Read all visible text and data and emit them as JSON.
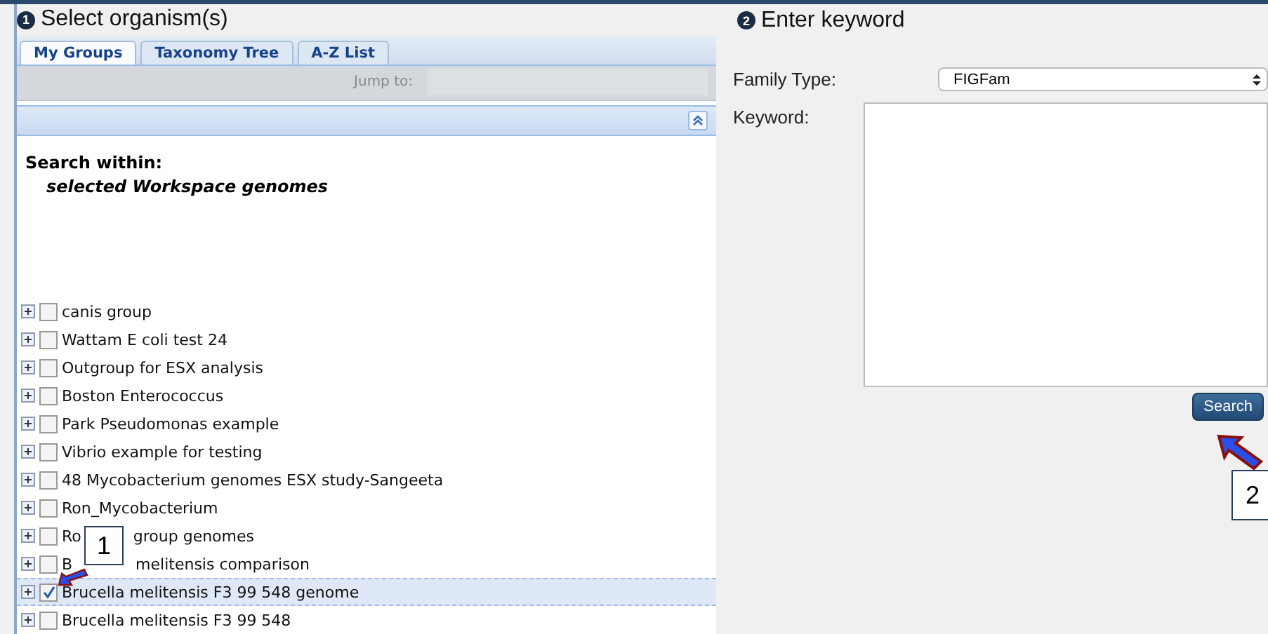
{
  "left_panel": {
    "step": "1",
    "title": "Select organism(s)",
    "tabs": [
      {
        "label": "My Groups",
        "selected": true
      },
      {
        "label": "Taxonomy Tree",
        "selected": false
      },
      {
        "label": "A-Z List",
        "selected": false
      }
    ],
    "jump_to": {
      "label": "Jump to:"
    },
    "search_within": {
      "heading": "Search within:",
      "value": "selected Workspace genomes"
    },
    "groups": [
      {
        "label_parts": [
          "canis group"
        ],
        "checked": false,
        "selected": false
      },
      {
        "label_parts": [
          "Wattam E coli test 24"
        ],
        "checked": false,
        "selected": false
      },
      {
        "label_parts": [
          "Outgroup for ESX analysis"
        ],
        "checked": false,
        "selected": false
      },
      {
        "label_parts": [
          "Boston Enterococcus"
        ],
        "checked": false,
        "selected": false
      },
      {
        "label_parts": [
          "Park Pseudomonas example"
        ],
        "checked": false,
        "selected": false
      },
      {
        "label_parts": [
          "Vibrio example for testing"
        ],
        "checked": false,
        "selected": false
      },
      {
        "label_parts": [
          "48 Mycobacterium genomes ESX study-Sangeeta"
        ],
        "checked": false,
        "selected": false
      },
      {
        "label_parts": [
          "Ron_Mycobacterium"
        ],
        "checked": false,
        "selected": false
      },
      {
        "label_parts": [
          "Ro",
          "group genomes"
        ],
        "checked": false,
        "selected": false
      },
      {
        "label_parts": [
          "B",
          "melitensis comparison"
        ],
        "checked": false,
        "selected": false
      },
      {
        "label_parts": [
          "Brucella melitensis F3 99 548 genome"
        ],
        "checked": true,
        "selected": true
      },
      {
        "label_parts": [
          "Brucella melitensis F3 99 548"
        ],
        "checked": false,
        "selected": false
      }
    ]
  },
  "right_panel": {
    "step": "2",
    "title": "Enter keyword",
    "family_type": {
      "label": "Family Type:",
      "value": "FIGFam"
    },
    "keyword": {
      "label": "Keyword:"
    },
    "search_button": "Search"
  },
  "callouts": [
    "1",
    "2"
  ]
}
